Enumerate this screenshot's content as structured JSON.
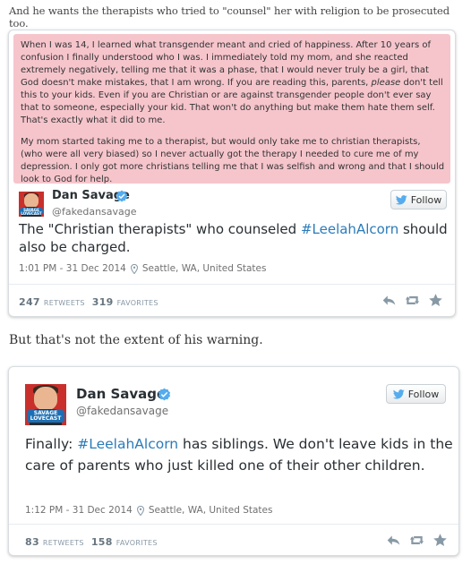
{
  "intro_line": "And he wants the therapists who tried to \"counsel\" her with religion to be prosecuted too.",
  "quoted_note": {
    "p1_before": "When I was 14, I learned what transgender meant and cried of happiness. After 10 years of confusion I finally understood who I was. I immediately told my mom, and she reacted extremely negatively, telling me that it was a phase, that I would never truly be a girl, that God doesn't make mistakes, that I am wrong. If you are reading this, parents, ",
    "p1_em": "please",
    "p1_after": " don't tell this to your kids. Even if you are Christian or are against transgender people don't ever say that to someone, especially your kid. That won't do anything but make them hate them self. That's exactly what it did to me.",
    "p2": "My mom started taking me to a therapist, but would only take me to christian therapists, (who were all very biased) so I never actually got the therapy I needed to cure me of my depression. I only got more christians telling me that I was selfish and wrong and that I should look to God for help."
  },
  "middle_line": "But that's not the extent of his warning.",
  "avatar_badge": [
    "SAVAGE",
    "LOVECAST"
  ],
  "tweets": [
    {
      "author_name": "Dan Savage",
      "author_handle": "@fakedansavage",
      "follow_label": "Follow",
      "text_before": "The \"Christian therapists\" who counseled ",
      "hashtag": "#LeelahAlcorn",
      "text_after": " should also be charged.",
      "timestamp": "1:01 PM - 31 Dec 2014",
      "location": "Seattle, WA, United States",
      "retweets_count": "247",
      "retweets_label": "RETWEETS",
      "favorites_count": "319",
      "favorites_label": "FAVORITES"
    },
    {
      "author_name": "Dan Savage",
      "author_handle": "@fakedansavage",
      "follow_label": "Follow",
      "text_before": "Finally: ",
      "hashtag": "#LeelahAlcorn",
      "text_after": " has siblings. We don't leave kids in the care of parents who just killed one of their other children.",
      "timestamp": "1:12 PM - 31 Dec 2014",
      "location": "Seattle, WA, United States",
      "retweets_count": "83",
      "retweets_label": "RETWEETS",
      "favorites_count": "158",
      "favorites_label": "FAVORITES"
    }
  ],
  "icons": {
    "verified": "verified-badge-icon",
    "follow_bird": "twitter-bird-icon",
    "location": "location-pin-icon",
    "reply": "reply-icon",
    "retweet": "retweet-icon",
    "favorite": "star-icon"
  },
  "colors": {
    "quote_background": "#f6c5cc",
    "hashtag": "#2b7bb9",
    "verified": "#55acee",
    "twitter_bird": "#55acee",
    "action_icon": "#8899a6"
  }
}
